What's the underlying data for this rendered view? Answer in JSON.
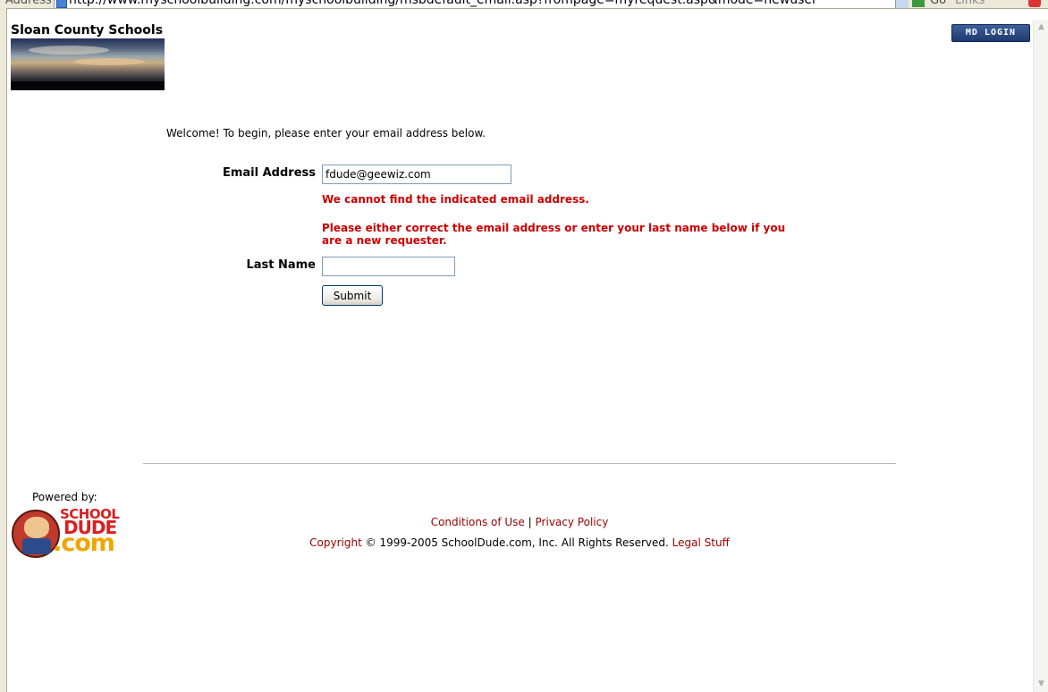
{
  "browser": {
    "address_label": "Address",
    "url": "http://www.myschoolbuilding.com/myschoolbuilding/msbdefault_email.asp?frompage=myrequest.asp&mode=newuser",
    "go_label": "Go",
    "links_label": "Links"
  },
  "header": {
    "site_title": "Sloan County Schools",
    "login_button": "MD LOGIN"
  },
  "form": {
    "welcome": "Welcome! To begin, please enter your email address below.",
    "email_label": "Email Address",
    "email_value": "fdude@geewiz.com",
    "error_not_found": "We cannot find the indicated email address.",
    "error_instructions": "Please either correct the email address or enter your last name below if you are a new requester.",
    "lastname_label": "Last Name",
    "lastname_value": "",
    "submit_label": "Submit"
  },
  "footer": {
    "powered_by": "Powered by:",
    "logo": {
      "school": "SCHOOL",
      "dude": "DUDE",
      "com": ".com"
    },
    "conditions_link": "Conditions of Use",
    "separator": "|",
    "privacy_link": "Privacy Policy",
    "copyright_link": "Copyright",
    "copyright_text": "© 1999-2005 SchoolDude.com, Inc. All Rights Reserved.",
    "legal_link": "Legal Stuff"
  },
  "colors": {
    "error_red": "#cc0000",
    "link_red": "#990000",
    "login_blue": "#1f3a70"
  },
  "icons": {
    "page_icon": "page-icon",
    "go_icon": "go-arrow-icon",
    "scroll_up": "scroll-up-arrow-icon",
    "scroll_down": "scroll-down-arrow-icon"
  }
}
